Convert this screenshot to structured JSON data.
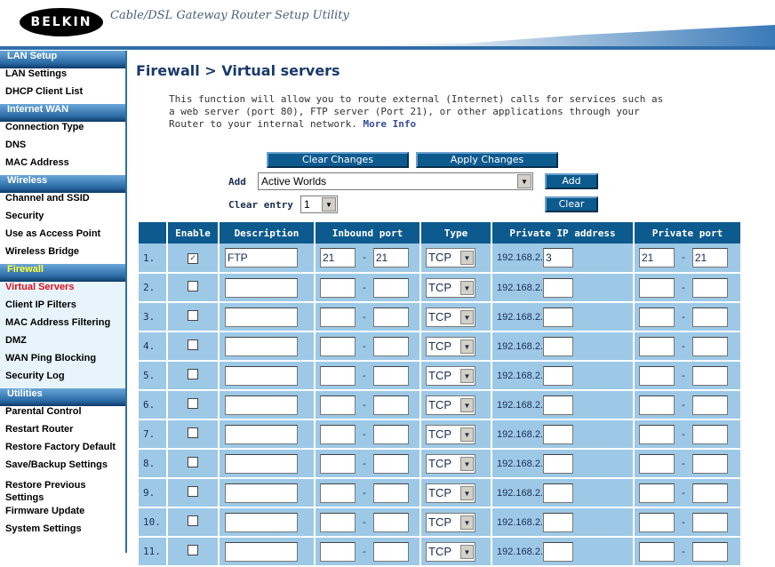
{
  "header": {
    "logo": "BELKIN",
    "tagline": "Cable/DSL Gateway Router Setup Utility"
  },
  "sidebar": [
    {
      "type": "section",
      "label": "LAN Setup"
    },
    {
      "type": "item",
      "label": "LAN Settings"
    },
    {
      "type": "item",
      "label": "DHCP Client List"
    },
    {
      "type": "section",
      "label": "Internet WAN"
    },
    {
      "type": "item",
      "label": "Connection Type"
    },
    {
      "type": "item",
      "label": "DNS"
    },
    {
      "type": "item",
      "label": "MAC Address"
    },
    {
      "type": "section",
      "label": "Wireless"
    },
    {
      "type": "item",
      "label": "Channel and SSID"
    },
    {
      "type": "item",
      "label": "Security"
    },
    {
      "type": "item",
      "label": "Use as Access Point"
    },
    {
      "type": "item",
      "label": "Wireless Bridge"
    },
    {
      "type": "section",
      "label": "Firewall",
      "fw": true
    },
    {
      "type": "item",
      "label": "Virtual Servers",
      "sub": true,
      "active": true
    },
    {
      "type": "item",
      "label": "Client IP Filters",
      "sub": true
    },
    {
      "type": "item",
      "label": "MAC Address Filtering",
      "sub": true
    },
    {
      "type": "item",
      "label": "DMZ",
      "sub": true
    },
    {
      "type": "item",
      "label": "WAN Ping Blocking",
      "sub": true
    },
    {
      "type": "item",
      "label": "Security Log",
      "sub": true
    },
    {
      "type": "section",
      "label": "Utilities"
    },
    {
      "type": "item",
      "label": "Parental Control"
    },
    {
      "type": "item",
      "label": "Restart Router"
    },
    {
      "type": "item",
      "label": "Restore Factory Default"
    },
    {
      "type": "item",
      "label": "Save/Backup Settings"
    },
    {
      "type": "item",
      "label": "Restore Previous Settings",
      "two": true
    },
    {
      "type": "item",
      "label": "Firmware Update"
    },
    {
      "type": "item",
      "label": "System Settings"
    }
  ],
  "main": {
    "title": "Firewall > Virtual servers",
    "description": "This function will allow you to route external (Internet) calls for services such as a web server (port 80), FTP server (Port 21), or other applications through your Router to your internal network.",
    "more_info": "More Info",
    "clear_changes": "Clear Changes",
    "apply_changes": "Apply Changes",
    "add_label": "Add",
    "add_select": "Active Worlds",
    "add_button": "Add",
    "clear_entry_label": "Clear entry",
    "clear_entry_select": "1",
    "clear_button": "Clear"
  },
  "table": {
    "headers": [
      "",
      "Enable",
      "Description",
      "Inbound port",
      "Type",
      "Private IP address",
      "Private port"
    ],
    "ip_prefix": "192.168.2.",
    "rows": [
      {
        "num": "1.",
        "enabled": true,
        "desc": "FTP",
        "in_from": "21",
        "in_to": "21",
        "type": "TCP",
        "ip": "3",
        "priv_from": "21",
        "priv_to": "21"
      },
      {
        "num": "2.",
        "enabled": false,
        "desc": "",
        "in_from": "",
        "in_to": "",
        "type": "TCP",
        "ip": "",
        "priv_from": "",
        "priv_to": ""
      },
      {
        "num": "3.",
        "enabled": false,
        "desc": "",
        "in_from": "",
        "in_to": "",
        "type": "TCP",
        "ip": "",
        "priv_from": "",
        "priv_to": ""
      },
      {
        "num": "4.",
        "enabled": false,
        "desc": "",
        "in_from": "",
        "in_to": "",
        "type": "TCP",
        "ip": "",
        "priv_from": "",
        "priv_to": ""
      },
      {
        "num": "5.",
        "enabled": false,
        "desc": "",
        "in_from": "",
        "in_to": "",
        "type": "TCP",
        "ip": "",
        "priv_from": "",
        "priv_to": ""
      },
      {
        "num": "6.",
        "enabled": false,
        "desc": "",
        "in_from": "",
        "in_to": "",
        "type": "TCP",
        "ip": "",
        "priv_from": "",
        "priv_to": ""
      },
      {
        "num": "7.",
        "enabled": false,
        "desc": "",
        "in_from": "",
        "in_to": "",
        "type": "TCP",
        "ip": "",
        "priv_from": "",
        "priv_to": ""
      },
      {
        "num": "8.",
        "enabled": false,
        "desc": "",
        "in_from": "",
        "in_to": "",
        "type": "TCP",
        "ip": "",
        "priv_from": "",
        "priv_to": ""
      },
      {
        "num": "9.",
        "enabled": false,
        "desc": "",
        "in_from": "",
        "in_to": "",
        "type": "TCP",
        "ip": "",
        "priv_from": "",
        "priv_to": ""
      },
      {
        "num": "10.",
        "enabled": false,
        "desc": "",
        "in_from": "",
        "in_to": "",
        "type": "TCP",
        "ip": "",
        "priv_from": "",
        "priv_to": ""
      },
      {
        "num": "11.",
        "enabled": false,
        "desc": "",
        "in_from": "",
        "in_to": "",
        "type": "TCP",
        "ip": "",
        "priv_from": "",
        "priv_to": ""
      }
    ]
  }
}
